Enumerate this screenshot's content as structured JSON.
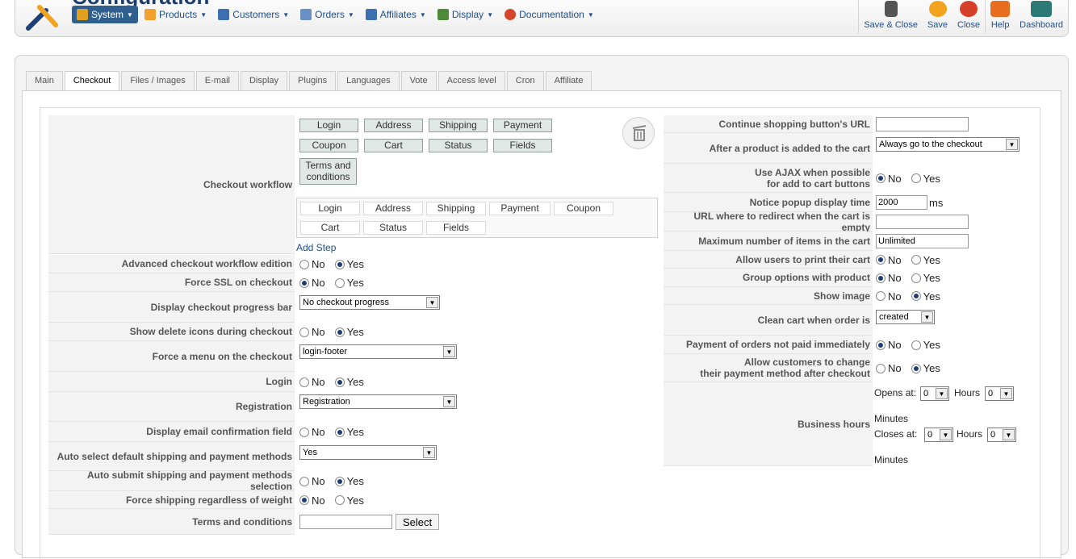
{
  "page": {
    "title": "Configuration"
  },
  "menu": [
    {
      "label": "System",
      "icon": "wrench-icon",
      "color": "#e0a020"
    },
    {
      "label": "Products",
      "icon": "box-icon",
      "color": "#f2a12e"
    },
    {
      "label": "Customers",
      "icon": "users-icon",
      "color": "#3d6fb0"
    },
    {
      "label": "Orders",
      "icon": "orders-icon",
      "color": "#6a8fc4"
    },
    {
      "label": "Affiliates",
      "icon": "affiliates-icon",
      "color": "#3d6fb0"
    },
    {
      "label": "Display",
      "icon": "display-icon",
      "color": "#4c8a3a"
    },
    {
      "label": "Documentation",
      "icon": "help-ring-icon",
      "color": "#d6452a"
    }
  ],
  "toolbar": {
    "save_close": "Save & Close",
    "save": "Save",
    "close": "Close",
    "help": "Help",
    "dashboard": "Dashboard"
  },
  "tabs": [
    "Main",
    "Checkout",
    "Files / Images",
    "E-mail",
    "Display",
    "Plugins",
    "Languages",
    "Vote",
    "Access level",
    "Cron",
    "Affiliate"
  ],
  "active_tab": "Checkout",
  "left": {
    "checkout_workflow": {
      "label": "Checkout workflow",
      "steps": [
        "Login",
        "Address",
        "Shipping",
        "Payment",
        "Coupon",
        "Cart",
        "Status",
        "Fields",
        "Terms and conditions"
      ],
      "pool": [
        "Login",
        "Address",
        "Shipping",
        "Payment",
        "Coupon",
        "Cart",
        "Status",
        "Fields"
      ],
      "add_step": "Add Step"
    },
    "advanced_workflow": {
      "label": "Advanced checkout workflow edition",
      "no": "No",
      "yes": "Yes"
    },
    "force_ssl": {
      "label": "Force SSL on checkout",
      "no": "No",
      "yes": "Yes"
    },
    "progress_bar": {
      "label": "Display checkout progress bar",
      "value": "No checkout progress"
    },
    "delete_icons": {
      "label": "Show delete icons during checkout",
      "no": "No",
      "yes": "Yes"
    },
    "force_menu": {
      "label": "Force a menu on the checkout",
      "value": "login-footer"
    },
    "login": {
      "label": "Login",
      "no": "No",
      "yes": "Yes"
    },
    "registration": {
      "label": "Registration",
      "value": "Registration"
    },
    "email_confirm": {
      "label": "Display email confirmation field",
      "no": "No",
      "yes": "Yes"
    },
    "auto_select": {
      "label": "Auto select default shipping and payment methods",
      "value": "Yes"
    },
    "auto_submit": {
      "label": "Auto submit shipping and payment methods selection",
      "no": "No",
      "yes": "Yes"
    },
    "force_shipping": {
      "label": "Force shipping regardless of weight",
      "no": "No",
      "yes": "Yes"
    },
    "terms": {
      "label": "Terms and conditions",
      "button": "Select"
    }
  },
  "right": {
    "continue_url": {
      "label": "Continue shopping button's URL",
      "value": ""
    },
    "after_add": {
      "label": "After a product is added to the cart",
      "value": "Always go to the checkout"
    },
    "ajax": {
      "label_1": "Use AJAX when possible",
      "label_2": "for add to cart buttons",
      "no": "No",
      "yes": "Yes"
    },
    "popup_time": {
      "label": "Notice popup display time",
      "value": "2000",
      "unit": "ms"
    },
    "empty_redirect": {
      "label": "URL where to redirect when the cart is empty",
      "value": ""
    },
    "max_items": {
      "label": "Maximum number of items in the cart",
      "value": "Unlimited"
    },
    "print_cart": {
      "label": "Allow users to print their cart",
      "no": "No",
      "yes": "Yes"
    },
    "group_options": {
      "label": "Group options with product",
      "no": "No",
      "yes": "Yes"
    },
    "show_image": {
      "label": "Show image",
      "no": "No",
      "yes": "Yes"
    },
    "clean_cart": {
      "label": "Clean cart when order is",
      "value": "created"
    },
    "unpaid": {
      "label": "Payment of orders not paid immediately",
      "no": "No",
      "yes": "Yes"
    },
    "change_payment": {
      "label_1": "Allow customers to change",
      "label_2": "their payment method after checkout",
      "no": "No",
      "yes": "Yes"
    },
    "business_hours": {
      "label": "Business hours",
      "opens": "Opens at:",
      "closes": "Closes at:",
      "hours": "Hours",
      "minutes": "Minutes",
      "open_h": "0",
      "open_m": "0",
      "close_h": "0",
      "close_m": "0"
    }
  }
}
